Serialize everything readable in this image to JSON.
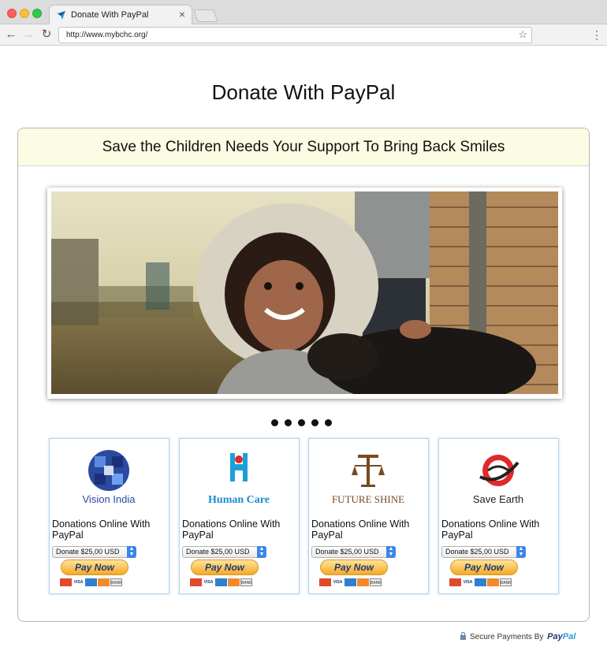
{
  "browser": {
    "tab_title": "Donate With PayPal",
    "url": "http://www.mybchc.org/"
  },
  "page": {
    "title": "Donate With PayPal",
    "panel_heading": "Save the Children Needs Your Support To Bring Back Smiles",
    "slider_dot_count": 5
  },
  "cards": [
    {
      "logo_text": "Vision India",
      "label": "Donations Online With PayPal",
      "select_value": "Donate $25,00 USD",
      "button": "Pay Now"
    },
    {
      "logo_text": "Human Care",
      "label": "Donations Online With PayPal",
      "select_value": "Donate $25,00 USD",
      "button": "Pay Now"
    },
    {
      "logo_text": "FUTURE SHINE",
      "label": "Donations Online With PayPal",
      "select_value": "Donate $25,00 USD",
      "button": "Pay Now"
    },
    {
      "logo_text": "Save Earth",
      "label": "Donations Online With PayPal",
      "select_value": "Donate $25,00 USD",
      "button": "Pay Now"
    }
  ],
  "accepted_cards": [
    "MasterCard",
    "VISA",
    "AMEX",
    "DISCOVER",
    "BANK"
  ],
  "footer": {
    "secure_text": "Secure Payments By",
    "paypal_part1": "Pay",
    "paypal_part2": "Pal"
  },
  "colors": {
    "panel_heading_bg": "#fcfce4",
    "paynow_gold": "#f7a824",
    "paypal_dark_blue": "#1e3a74",
    "paypal_light_blue": "#2f9ad8"
  }
}
